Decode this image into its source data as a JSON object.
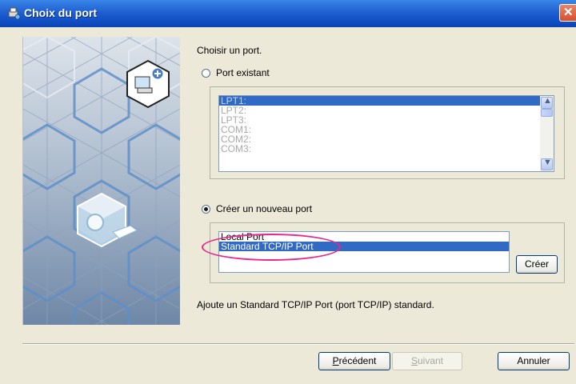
{
  "window": {
    "title": "Choix du port",
    "close_glyph": "✕"
  },
  "main": {
    "prompt": "Choisir un port.",
    "existing_port": {
      "label": "Port existant",
      "selected": false,
      "ports": [
        "LPT1:",
        "LPT2:",
        "LPT3:",
        "COM1:",
        "COM2:",
        "COM3:"
      ],
      "selected_port": "LPT1:"
    },
    "new_port": {
      "label": "Créer un nouveau port",
      "selected": true,
      "port_types": [
        "Local Port",
        "Standard TCP/IP Port"
      ],
      "selected_type": "Standard TCP/IP Port",
      "create_button": "Créer"
    },
    "description": "Ajoute un Standard TCP/IP Port (port TCP/IP) standard."
  },
  "footer": {
    "back_button": "Précédent",
    "back_mnemonic": "P",
    "back_rest": "récédent",
    "next_button": "Suivant",
    "next_mnemonic": "S",
    "next_rest": "uivant",
    "cancel_button": "Annuler"
  },
  "colors": {
    "title_bar": "#1f5fd0",
    "selection": "#316ac5",
    "highlight_ellipse": "#e8268c",
    "dialog_background": "#ece9d8"
  },
  "icons": {
    "title": "printer-network-icon",
    "add_printer": "add-printer-icon",
    "port_cube": "port-cube-icon"
  }
}
